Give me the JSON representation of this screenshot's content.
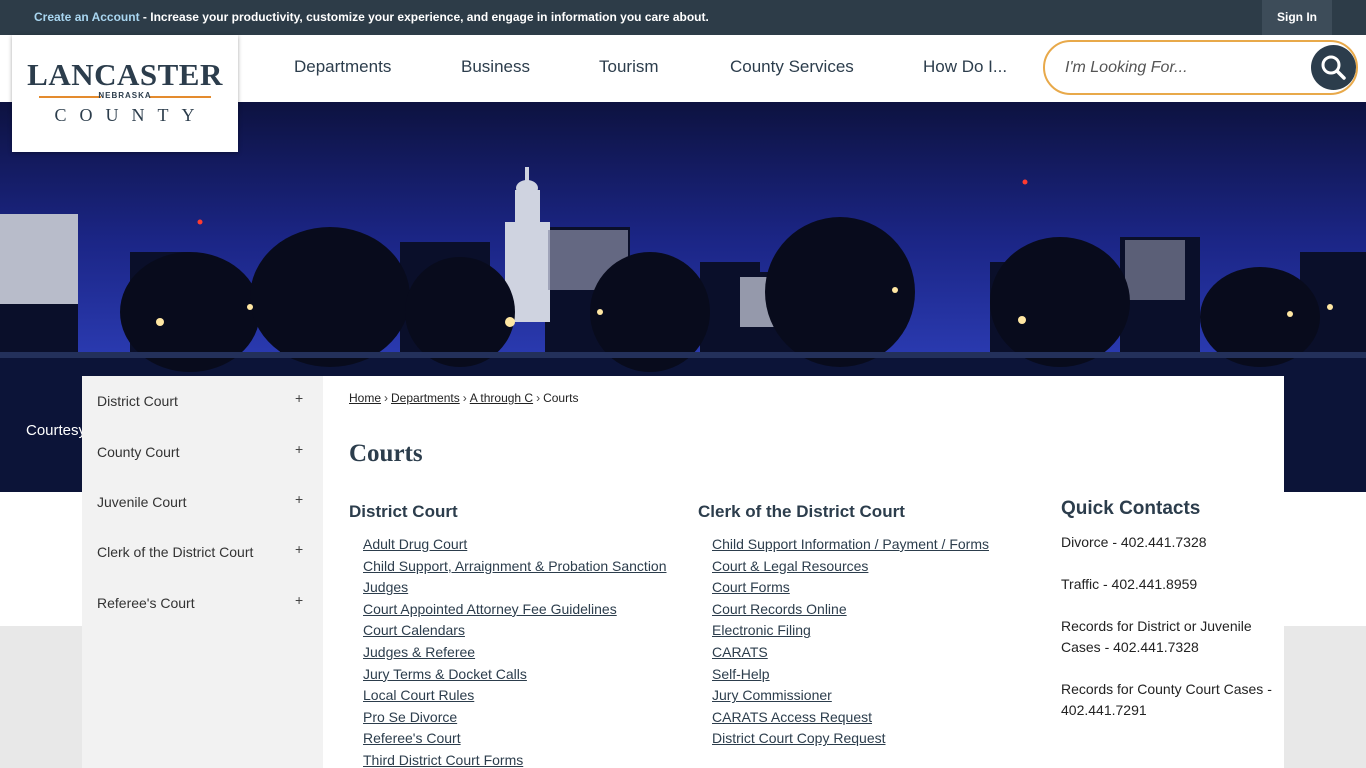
{
  "topbar": {
    "create_account": "Create an Account",
    "message": " - Increase your productivity, customize your experience, and engage in information you care about.",
    "sign_in": "Sign In"
  },
  "logo": {
    "name": "LANCASTER",
    "state": "NEBRASKA",
    "county": "COUNTY"
  },
  "nav": {
    "items": [
      "Departments",
      "Business",
      "Tourism",
      "County Services",
      "How Do I..."
    ]
  },
  "search": {
    "placeholder": "I'm Looking For..."
  },
  "hero": {
    "caption": "Courtesy"
  },
  "sidebar": {
    "items": [
      {
        "label": "District Court"
      },
      {
        "label": "County Court"
      },
      {
        "label": "Juvenile Court"
      },
      {
        "label": "Clerk of the District Court"
      },
      {
        "label": "Referee's Court"
      }
    ],
    "expand_symbol": "+"
  },
  "breadcrumb": {
    "home": "Home",
    "departments": "Departments",
    "group": "A through C",
    "current": "Courts",
    "separator": "›"
  },
  "page": {
    "title": "Courts"
  },
  "district_court": {
    "heading": "District Court",
    "links": [
      "Adult Drug Court",
      "Child Support, Arraignment & Probation Sanction Judges",
      "Court Appointed Attorney Fee Guidelines",
      "Court Calendars",
      "Judges & Referee",
      "Jury Terms & Docket Calls",
      "Local Court Rules",
      "Pro Se Divorce",
      "Referee's Court",
      "Third District Court Forms"
    ]
  },
  "clerk": {
    "heading": "Clerk of the District Court",
    "links": [
      "Child Support Information / Payment / Forms",
      "Court & Legal Resources",
      "Court Forms",
      "Court Records Online",
      "Electronic Filing",
      "CARATS",
      "Self-Help",
      "Jury Commissioner",
      "CARATS Access Request",
      "District Court Copy Request"
    ]
  },
  "quick_contacts": {
    "title": "Quick Contacts",
    "entries": [
      "Divorce - 402.441.7328",
      "Traffic - 402.441.8959",
      "Records for District or Juvenile Cases - 402.441.7328",
      "Records for County Court Cases - 402.441.7291"
    ]
  },
  "colors": {
    "topbar": "#2d3c48",
    "navy": "#2c3d4c",
    "accent": "#e8a94a"
  }
}
